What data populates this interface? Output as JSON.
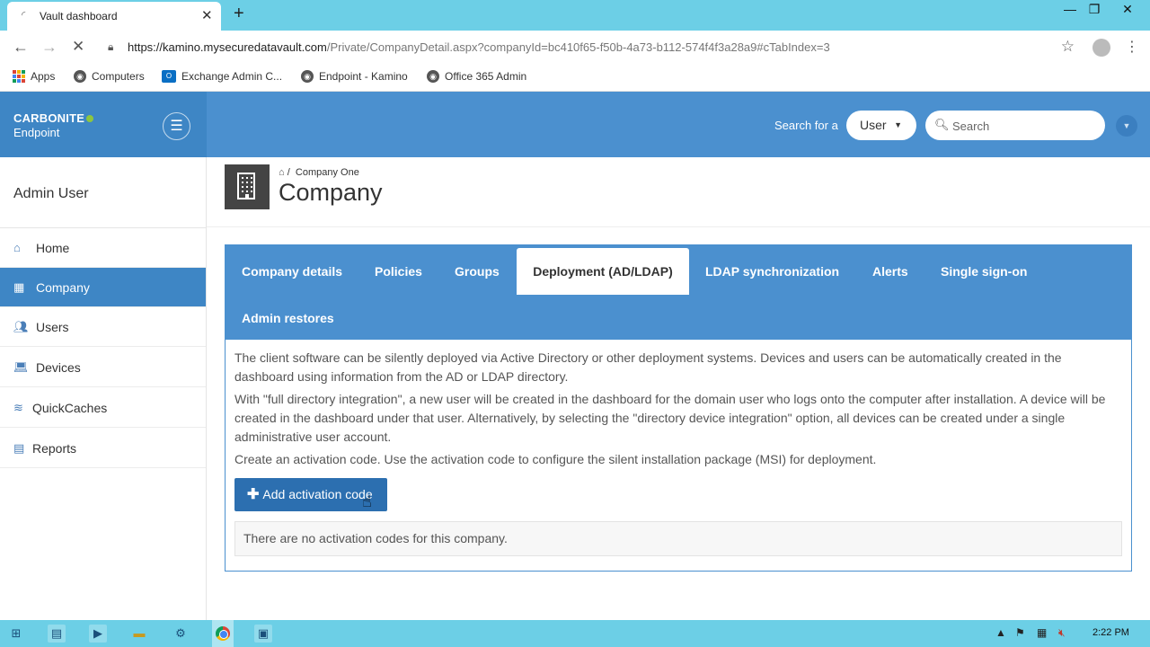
{
  "browser": {
    "tab_title": "Vault dashboard",
    "tab_close": "✕",
    "new_tab": "+",
    "window_controls": {
      "minimize": "—",
      "maximize": "❐",
      "close": "✕"
    },
    "url_host": "https://kamino.mysecuredatavault.com",
    "url_path": "/Private/CompanyDetail.aspx?companyId=bc410f65-f50b-4a73-b112-574f4f3a28a9#cTabIndex=3",
    "bookmarks": [
      {
        "label": "Apps",
        "icon": "apps-grid-icon"
      },
      {
        "label": "Computers",
        "icon": "globe-icon"
      },
      {
        "label": "Exchange Admin C...",
        "icon": "outlook-icon"
      },
      {
        "label": "Endpoint - Kamino",
        "icon": "globe-icon"
      },
      {
        "label": "Office 365 Admin",
        "icon": "globe-icon"
      }
    ]
  },
  "header": {
    "brand_name": "CARBONITE",
    "brand_product": "Endpoint",
    "search_for_label": "Search for a",
    "search_type": "User",
    "search_placeholder": "Search"
  },
  "sidebar": {
    "user_name": "Admin User",
    "items": [
      {
        "label": "Home",
        "icon": "home-icon",
        "active": false
      },
      {
        "label": "Company",
        "icon": "building-icon",
        "active": true
      },
      {
        "label": "Users",
        "icon": "users-icon",
        "active": false
      },
      {
        "label": "Devices",
        "icon": "laptop-icon",
        "active": false
      },
      {
        "label": "QuickCaches",
        "icon": "database-icon",
        "active": false
      },
      {
        "label": "Reports",
        "icon": "report-icon",
        "active": false
      }
    ]
  },
  "page": {
    "breadcrumb_sep": "/",
    "breadcrumb_current": "Company One",
    "title": "Company"
  },
  "tabs": [
    {
      "label": "Company details",
      "active": false
    },
    {
      "label": "Policies",
      "active": false
    },
    {
      "label": "Groups",
      "active": false
    },
    {
      "label": "Deployment (AD/LDAP)",
      "active": true
    },
    {
      "label": "LDAP synchronization",
      "active": false
    },
    {
      "label": "Alerts",
      "active": false
    },
    {
      "label": "Single sign-on",
      "active": false
    },
    {
      "label": "Admin restores",
      "active": false
    }
  ],
  "content": {
    "para1": "The client software can be silently deployed via Active Directory or other deployment systems. Devices and users can be automatically created in the dashboard using information from the AD or LDAP directory.",
    "para2": "With \"full directory integration\", a new user will be created in the dashboard for the domain user who logs onto the computer after installation. A device will be created in the dashboard under that user. Alternatively, by selecting the \"directory device integration\" option, all devices can be created under a single administrative user account.",
    "para3": "Create an activation code. Use the activation code to configure the silent installation package (MSI) for deployment.",
    "add_button_label": "Add activation code",
    "empty_message": "There are no activation codes for this company."
  },
  "taskbar": {
    "clock": "2:22 PM"
  },
  "colors": {
    "brand_blue": "#3e86c5",
    "header_blue": "#4b90cf",
    "button_blue": "#2c6fb0",
    "chrome_frame": "#6ccfe6",
    "brand_green": "#8dc63f"
  }
}
